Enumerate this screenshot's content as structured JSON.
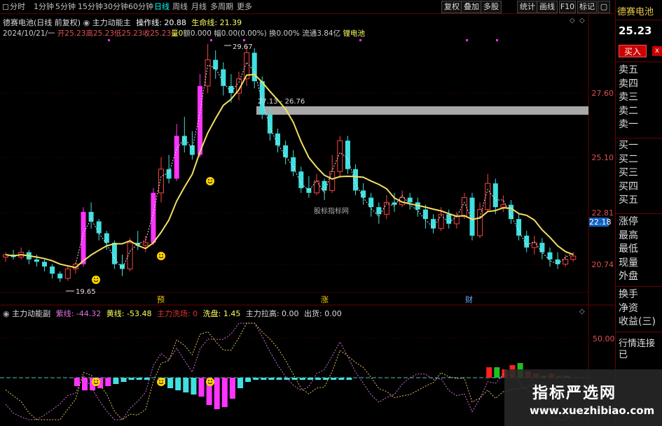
{
  "toolbar": {
    "tabs": [
      {
        "label": "分时",
        "active": false,
        "checkbox": true
      },
      {
        "label": "1分钟",
        "active": false
      },
      {
        "label": "5分钟",
        "active": false
      },
      {
        "label": "15分钟",
        "active": false
      },
      {
        "label": "30分钟",
        "active": false
      },
      {
        "label": "60分钟",
        "active": false
      },
      {
        "label": "日线",
        "active": true
      },
      {
        "label": "周线",
        "active": false
      },
      {
        "label": "月线",
        "active": false
      },
      {
        "label": "多周期",
        "active": false
      },
      {
        "label": "更多",
        "active": false
      }
    ],
    "right_buttons": [
      "复权",
      "叠加",
      "多股",
      "统计",
      "画线",
      "F10",
      "标记"
    ],
    "window_buttons": [
      "◀",
      "▶"
    ]
  },
  "main_chart": {
    "title_line": {
      "stock": "德赛电池(日线 前复权)",
      "indicator": "主力动能主",
      "op_label": "操作线: 20.88",
      "life_label": "生命线: 21.39"
    },
    "bar_line": {
      "date": "2024/10/21/一",
      "open": "开25.23",
      "high": "高25.23",
      "low": "低25.23",
      "close": "收25.23",
      "vol": "量0",
      "amount": "额0.000",
      "change": "幅0.00(0.00%)",
      "turnover": "换0.00%",
      "float": "流通3.84亿",
      "sector": "锂电池"
    },
    "annotations": {
      "high_mark": "29.67",
      "low_mark": "19.65",
      "range_label": "27.13 - 26.76",
      "watermark_text": "股标指标网"
    },
    "price_ticks": [
      "27.60",
      "25.10",
      "22.81",
      "20.74"
    ],
    "current_price_tag": "22.18",
    "event_marks": [
      "预",
      "涨",
      "财"
    ]
  },
  "sub_chart": {
    "title": "主力动能副",
    "purple_label": "紫线: -44.32",
    "yellow_label": "黄线: -53.48",
    "main_wash": "主力洗场: 0",
    "wash": "洗盘: 1.45",
    "pull": "主力拉高: 0.00",
    "out": "出货: 0.00",
    "axis_tick": "50.00"
  },
  "right_panel": {
    "name": "德赛电池",
    "price": "25.23",
    "buy_label": "买入",
    "close_label": "x",
    "order_book": [
      "卖五",
      "卖四",
      "卖三",
      "卖二",
      "卖一",
      "买一",
      "买二",
      "买三",
      "买四",
      "买五"
    ],
    "stats": [
      "涨停",
      "最高",
      "最低",
      "现量",
      "外盘"
    ],
    "stats2": [
      "换手",
      "净资",
      "收益(三)"
    ],
    "bottom_tab": "行情连接已"
  },
  "overlay_watermark": {
    "cn": "指标严选网",
    "url": "www.xuezhibiao.com"
  },
  "chart_data": {
    "type": "candlestick",
    "candles": [
      [
        20.7,
        20.8,
        20.9,
        20.5
      ],
      [
        20.8,
        20.7,
        21.0,
        20.6
      ],
      [
        20.7,
        20.9,
        21.1,
        20.6
      ],
      [
        20.9,
        20.6,
        21.0,
        20.4
      ],
      [
        20.6,
        20.5,
        20.8,
        20.3
      ],
      [
        20.5,
        20.3,
        20.6,
        20.1
      ],
      [
        20.3,
        20.0,
        20.4,
        19.8
      ],
      [
        20.0,
        19.8,
        20.1,
        19.65
      ],
      [
        19.8,
        20.2,
        20.3,
        19.7
      ],
      [
        20.2,
        20.4,
        20.5,
        20.0
      ],
      [
        20.4,
        22.6,
        22.8,
        20.3
      ],
      [
        22.6,
        22.2,
        23.0,
        21.9
      ],
      [
        22.2,
        21.7,
        22.3,
        21.4
      ],
      [
        21.7,
        21.3,
        21.8,
        21.0
      ],
      [
        21.3,
        20.4,
        21.4,
        20.2
      ],
      [
        20.4,
        20.2,
        20.8,
        19.9
      ],
      [
        20.2,
        21.3,
        21.5,
        20.1
      ],
      [
        21.3,
        21.2,
        21.8,
        21.0
      ],
      [
        21.2,
        21.3,
        21.6,
        20.9
      ],
      [
        21.3,
        23.4,
        23.6,
        21.2
      ],
      [
        23.4,
        24.4,
        24.9,
        23.0
      ],
      [
        24.4,
        24.0,
        25.0,
        23.8
      ],
      [
        24.0,
        25.8,
        26.3,
        23.9
      ],
      [
        25.8,
        25.4,
        26.6,
        25.1
      ],
      [
        25.4,
        25.0,
        26.0,
        24.8
      ],
      [
        25.0,
        27.9,
        28.4,
        24.9
      ],
      [
        27.9,
        29.0,
        29.67,
        27.6
      ],
      [
        29.0,
        28.6,
        29.4,
        28.2
      ],
      [
        28.6,
        27.9,
        28.9,
        27.5
      ],
      [
        27.9,
        27.6,
        28.4,
        27.2
      ],
      [
        27.6,
        28.2,
        28.5,
        27.3
      ],
      [
        28.2,
        29.3,
        29.6,
        27.9
      ],
      [
        29.3,
        28.1,
        29.5,
        27.8
      ],
      [
        28.1,
        26.7,
        28.3,
        26.5
      ],
      [
        26.7,
        25.9,
        27.0,
        25.6
      ],
      [
        25.9,
        25.4,
        26.1,
        25.1
      ],
      [
        25.4,
        24.9,
        25.6,
        24.6
      ],
      [
        24.9,
        24.3,
        25.2,
        24.1
      ],
      [
        24.3,
        23.6,
        24.5,
        23.4
      ],
      [
        23.6,
        23.4,
        24.1,
        23.2
      ],
      [
        23.4,
        23.9,
        24.2,
        23.3
      ],
      [
        23.9,
        23.5,
        24.0,
        23.1
      ],
      [
        23.5,
        24.3,
        25.0,
        23.4
      ],
      [
        24.3,
        25.6,
        25.8,
        24.1
      ],
      [
        25.6,
        24.4,
        25.8,
        24.2
      ],
      [
        24.4,
        23.5,
        24.6,
        23.3
      ],
      [
        23.5,
        23.2,
        23.8,
        22.9
      ],
      [
        23.2,
        22.8,
        23.4,
        22.4
      ],
      [
        22.8,
        22.5,
        23.0,
        22.1
      ],
      [
        22.5,
        23.0,
        23.3,
        22.3
      ],
      [
        23.0,
        22.9,
        23.4,
        22.6
      ],
      [
        22.9,
        23.2,
        23.5,
        22.8
      ],
      [
        23.2,
        23.0,
        23.4,
        22.7
      ],
      [
        23.0,
        22.7,
        23.2,
        22.4
      ],
      [
        22.7,
        22.3,
        22.9,
        21.9
      ],
      [
        22.3,
        21.9,
        22.5,
        21.7
      ],
      [
        21.9,
        22.5,
        22.8,
        21.8
      ],
      [
        22.5,
        22.1,
        22.7,
        21.9
      ],
      [
        22.1,
        22.4,
        22.6,
        21.9
      ],
      [
        22.4,
        23.2,
        23.4,
        22.3
      ],
      [
        23.2,
        21.6,
        23.4,
        21.4
      ],
      [
        21.6,
        22.7,
        23.0,
        21.5
      ],
      [
        22.7,
        23.8,
        24.2,
        22.6
      ],
      [
        23.8,
        22.8,
        24.0,
        22.5
      ],
      [
        22.8,
        22.9,
        23.3,
        22.6
      ],
      [
        22.9,
        22.3,
        23.1,
        22.1
      ],
      [
        22.3,
        21.6,
        22.5,
        21.4
      ],
      [
        21.6,
        21.1,
        21.8,
        20.9
      ],
      [
        21.1,
        21.3,
        21.6,
        20.8
      ],
      [
        21.3,
        20.9,
        21.5,
        20.6
      ],
      [
        20.9,
        20.6,
        21.1,
        20.3
      ],
      [
        20.6,
        20.4,
        20.9,
        20.2
      ],
      [
        20.4,
        20.6,
        20.8,
        20.3
      ],
      [
        20.6,
        20.74,
        20.9,
        20.5
      ]
    ],
    "hist": [
      0,
      0,
      0,
      0,
      0,
      0,
      0,
      0,
      0,
      -4,
      -6,
      -6,
      -5,
      -4,
      -3,
      -2,
      -1,
      -1,
      -1,
      0,
      -3,
      -5,
      -6,
      -7,
      -8,
      -9,
      -13,
      -15,
      -14,
      -10,
      -5,
      -2,
      -1,
      -1,
      -1,
      -1,
      -1,
      -1,
      -1,
      -1,
      -1,
      -1,
      -1,
      -1,
      -1,
      0,
      0,
      0,
      0,
      0,
      0,
      0,
      0,
      0,
      0,
      0,
      0,
      0,
      0,
      0,
      0,
      0,
      5,
      5,
      4,
      6,
      7,
      3,
      2,
      1,
      2,
      1,
      1,
      0
    ]
  }
}
